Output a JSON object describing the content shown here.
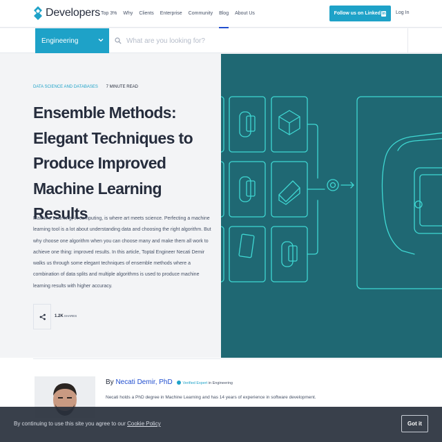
{
  "header": {
    "brand": "Developers",
    "nav": [
      "Top 3%",
      "Why",
      "Clients",
      "Enterprise",
      "Community",
      "Blog",
      "About Us"
    ],
    "follow_text": "Follow us on",
    "linkedin": "Linked",
    "linkedin_in": "in",
    "login": "Log In",
    "accent": "#1ea2c8"
  },
  "search": {
    "category": "Engineering",
    "placeholder": "What are you looking for?"
  },
  "article": {
    "category": "DATA SCIENCE AND DATABASES",
    "read_time": "7 MINUTE READ",
    "title": "Ensemble Methods: Elegant Techniques to Produce Improved Machine Learning Results",
    "summary": "Machine Learning, in computing, is where art meets science. Perfecting a machine learning tool is a lot about understanding data and choosing the right algorithm. But why choose one algorithm when you can choose many and make them all work to achieve one thing: improved results. In this article, Toptal Engineer Necati Demir walks us through some elegant techniques of ensemble methods where a combination of data splits and multiple algorithms is used to produce machine learning results with higher accuracy.",
    "shares_count": "1.2K",
    "shares_label": "SHARES",
    "hero_color": "#1f6873"
  },
  "author": {
    "by": "By",
    "name": "Necati Demir, PhD",
    "verified_label": "Verified Expert",
    "verified_suffix": "in Engineering",
    "bio": "Necati holds a PhD degree in Machine Learning and has 14 years of experience in software development."
  },
  "cookie": {
    "text": "By continuing to use this site you agree to our",
    "link": "Cookie Policy",
    "button": "Got it"
  }
}
